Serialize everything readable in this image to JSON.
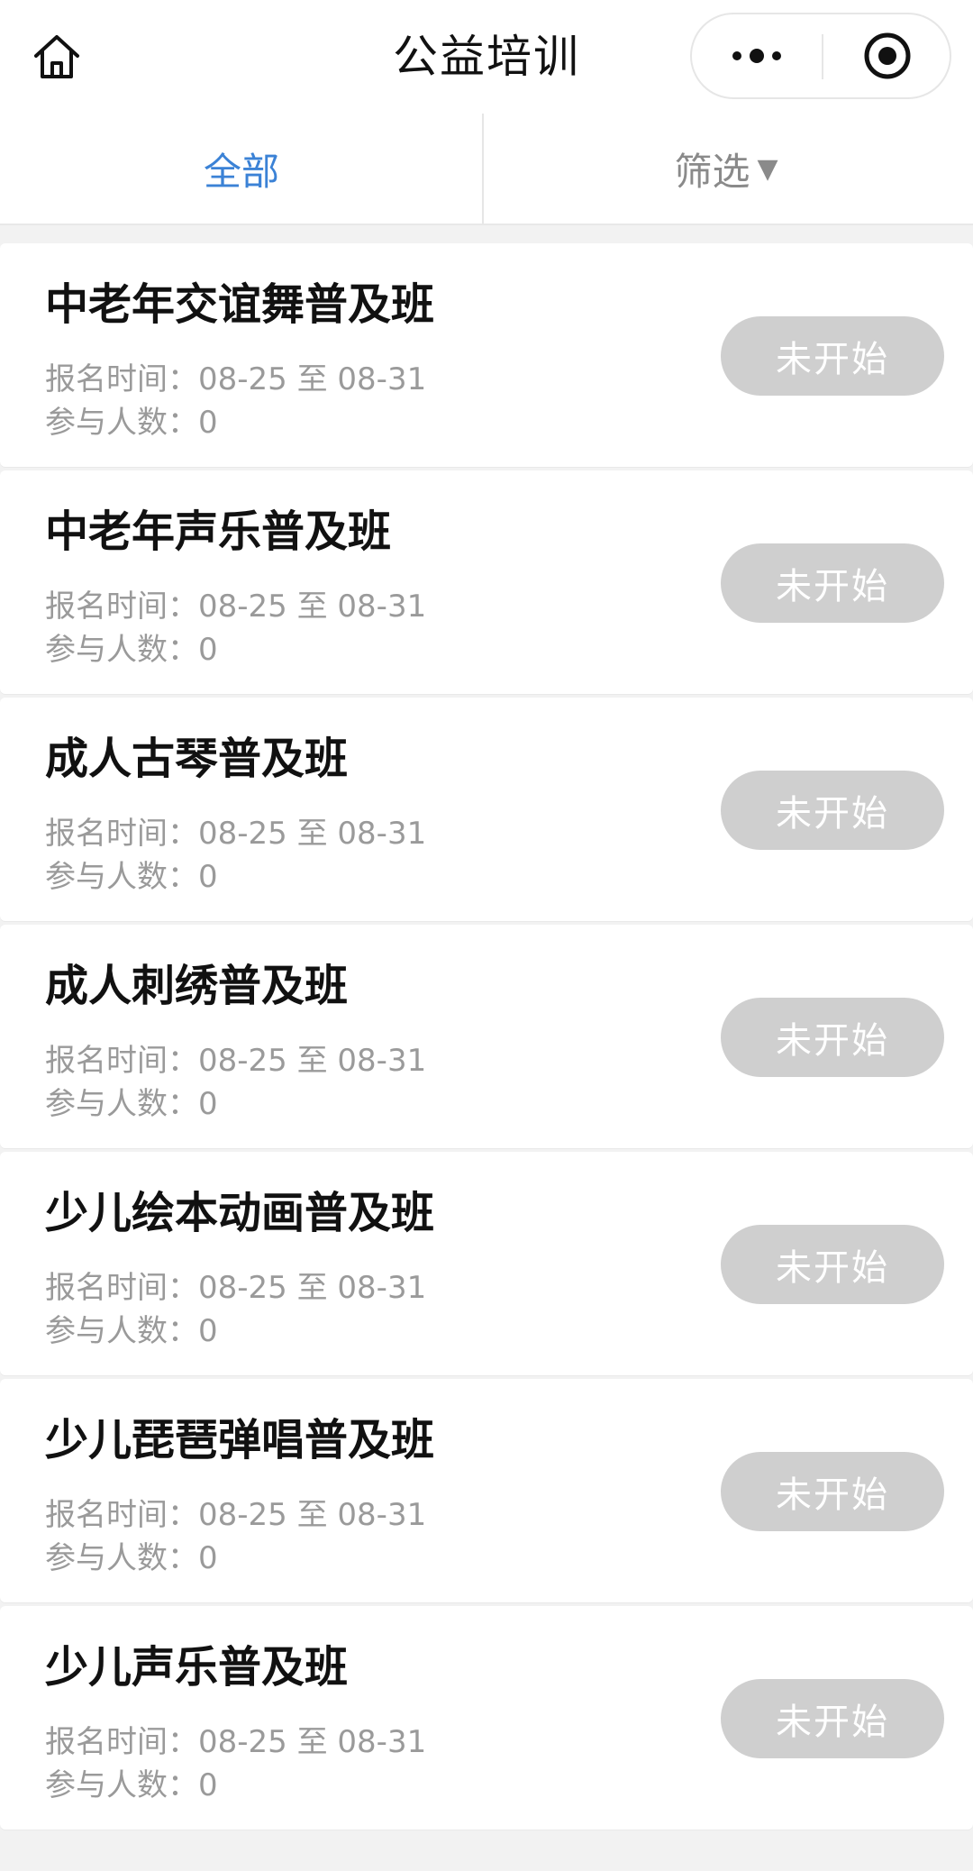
{
  "header": {
    "title": "公益培训",
    "home_icon": "home-icon",
    "more_icon": "more-dots-icon",
    "close_icon": "target-close-icon"
  },
  "tabs": {
    "all_label": "全部",
    "filter_label": "筛选",
    "filter_caret": "▼",
    "active_color": "#3b82d6"
  },
  "courses": [
    {
      "title": "中老年交谊舞普及班",
      "time": "报名时间：08-25 至 08-31",
      "count": "参与人数：0",
      "status": "未开始"
    },
    {
      "title": "中老年声乐普及班",
      "time": "报名时间：08-25 至 08-31",
      "count": "参与人数：0",
      "status": "未开始"
    },
    {
      "title": "成人古琴普及班",
      "time": "报名时间：08-25 至 08-31",
      "count": "参与人数：0",
      "status": "未开始"
    },
    {
      "title": "成人刺绣普及班",
      "time": "报名时间：08-25 至 08-31",
      "count": "参与人数：0",
      "status": "未开始"
    },
    {
      "title": "少儿绘本动画普及班",
      "time": "报名时间：08-25 至 08-31",
      "count": "参与人数：0",
      "status": "未开始"
    },
    {
      "title": "少儿琵琶弹唱普及班",
      "time": "报名时间：08-25 至 08-31",
      "count": "参与人数：0",
      "status": "未开始"
    },
    {
      "title": "少儿声乐普及班",
      "time": "报名时间：08-25 至 08-31",
      "count": "参与人数：0",
      "status": "未开始"
    }
  ]
}
